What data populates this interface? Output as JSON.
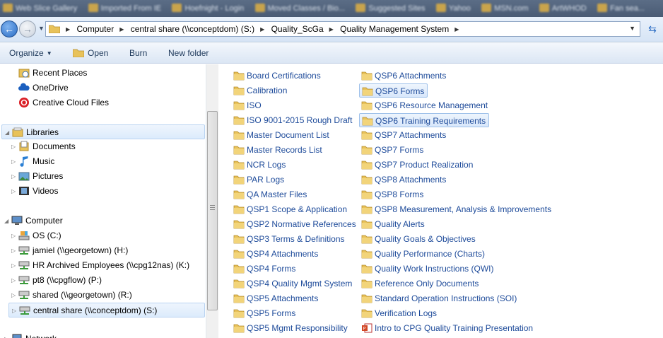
{
  "window": {
    "bookmarks": [
      "Web Slice Gallery",
      "Imported From IE",
      "Hoefnight - Login",
      "Moved Classes / Bio...",
      "Suggested Sites",
      "Yahoo",
      "MSN.com",
      "ArtWHOD",
      "Fan sea..."
    ],
    "address": {
      "crumbs": [
        "Computer",
        "central share (\\\\conceptdom) (S:)",
        "Quality_ScGa",
        "Quality Management System"
      ]
    },
    "toolbar": {
      "organize": "Organize",
      "open": "Open",
      "burn": "Burn",
      "new_folder": "New folder"
    },
    "nav": {
      "favorites": [
        "Recent Places",
        "OneDrive",
        "Creative Cloud Files"
      ],
      "libraries": {
        "label": "Libraries",
        "items": [
          "Documents",
          "Music",
          "Pictures",
          "Videos"
        ]
      },
      "computer": {
        "label": "Computer",
        "items": [
          "OS (C:)",
          "jamiel (\\\\georgetown) (H:)",
          "HR Archived Employees (\\\\cpg12nas) (K:)",
          "pt8 (\\\\cpgflow) (P:)",
          "shared (\\\\georgetown) (R:)",
          "central share (\\\\conceptdom) (S:)"
        ]
      },
      "network": "Network"
    },
    "files": {
      "col1": [
        "Board Certifications",
        "Calibration",
        "ISO",
        "ISO 9001-2015 Rough Draft",
        "Master Document List",
        "Master Records List",
        "NCR Logs",
        "PAR Logs",
        "QA Master Files",
        "QSP1 Scope & Application",
        "QSP2 Normative References",
        "QSP3 Terms & Definitions",
        "QSP4 Attachments",
        "QSP4 Forms",
        "QSP4 Quality Mgmt System",
        "QSP5 Attachments",
        "QSP5 Forms",
        "QSP5 Mgmt Responsibility"
      ],
      "col2": [
        "QSP6 Attachments",
        "QSP6 Forms",
        "QSP6 Resource Management",
        "QSP6 Training Requirements",
        "QSP7 Attachments",
        "QSP7 Forms",
        "QSP7 Product Realization",
        "QSP8 Attachments",
        "QSP8 Forms",
        "QSP8 Measurement, Analysis & Improvements",
        "Quality Alerts",
        "Quality Goals & Objectives",
        "Quality Performance (Charts)",
        "Quality Work Instructions (QWI)",
        "Reference Only Documents",
        "Standard Operation Instructions (SOI)",
        "Verification Logs",
        "Intro to CPG Quality Training Presentation"
      ]
    },
    "colors": {
      "folder": "#e8c25a",
      "link_text": "#1e4b9a",
      "selection": "#d8e7fb"
    }
  }
}
